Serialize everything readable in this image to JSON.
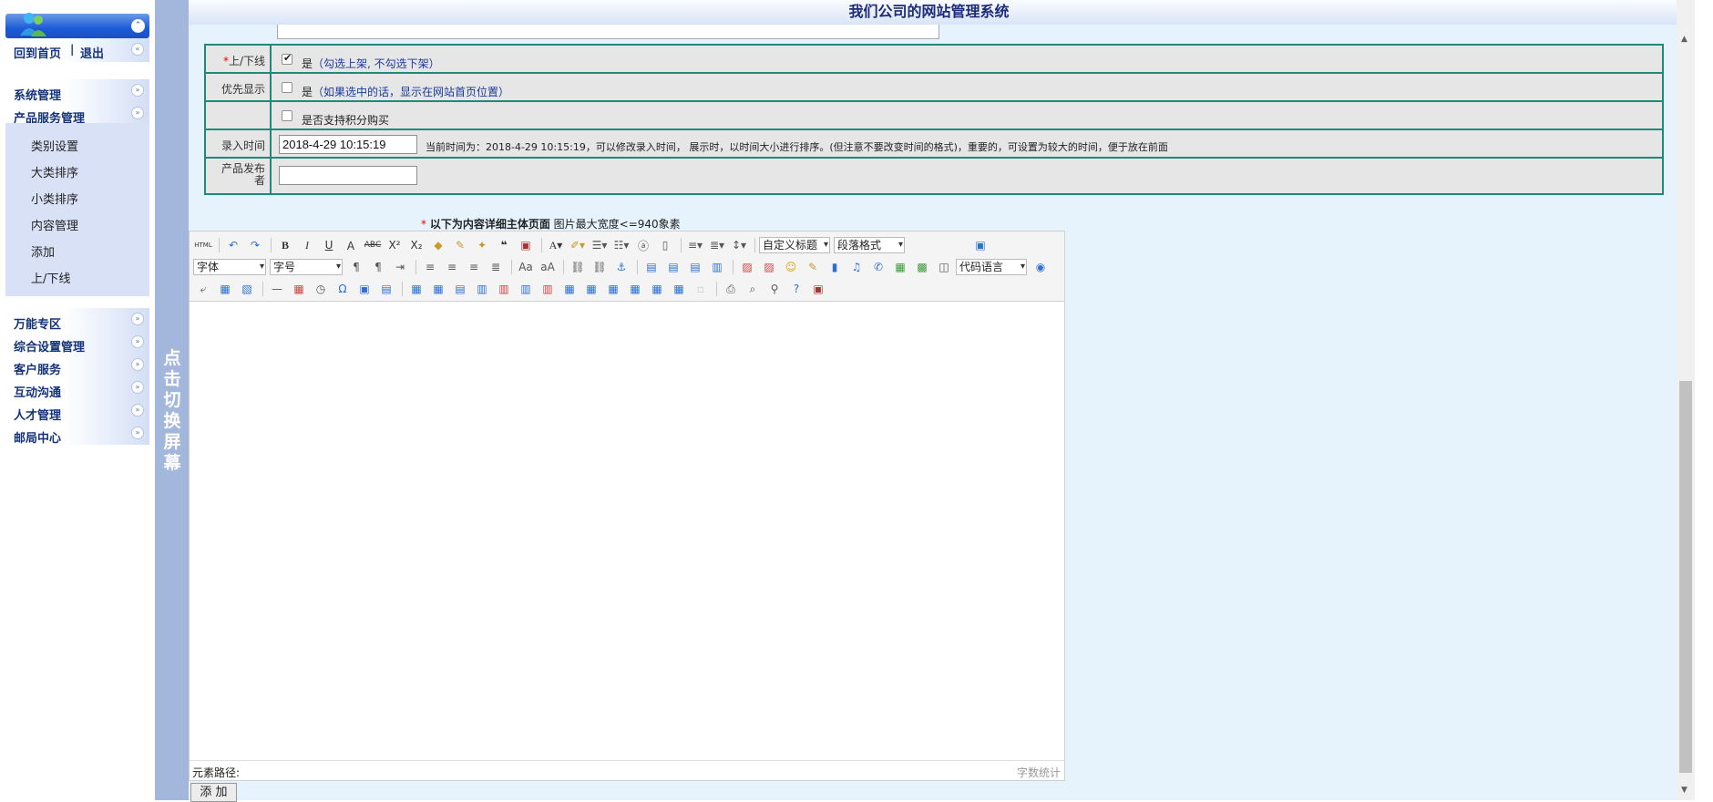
{
  "sidebar": {
    "home": "回到首页",
    "separator": "|",
    "logout": "退出",
    "menu": [
      {
        "label": "系统管理"
      },
      {
        "label": "产品服务管理"
      }
    ],
    "submenu": [
      "类别设置",
      "大类排序",
      "小类排序",
      "内容管理",
      "添加",
      "上/下线"
    ],
    "menu2": [
      {
        "label": "万能专区"
      },
      {
        "label": "综合设置管理"
      },
      {
        "label": "客户服务"
      },
      {
        "label": "互动沟通"
      },
      {
        "label": "人才管理"
      },
      {
        "label": "邮局中心"
      }
    ]
  },
  "splitter": {
    "text": "点击切换屏幕"
  },
  "header": {
    "title": "我们公司的网站管理系统"
  },
  "form": {
    "online": {
      "label": "上/下线",
      "required_mark": "*",
      "option": "是",
      "hint": "（勾选上架, 不勾选下架）"
    },
    "priority": {
      "label": "优先显示",
      "option": "是",
      "hint": "（如果选中的话，显示在网站首页位置）"
    },
    "points": {
      "option": "是否支持积分购买"
    },
    "entry_time": {
      "label": "录入时间",
      "value": "2018-4-29 10:15:19",
      "note": "当前时间为：2018-4-29 10:15:19，可以修改录入时间， 展示时，以时间大小进行排序。(但注意不要改变时间的格式)，重要的，可设置为较大的时间，便于放在前面"
    },
    "publisher": {
      "label": "产品发布者",
      "value": ""
    }
  },
  "editor": {
    "required_mark": "*",
    "title_bold": "以下为内容详细主体页面",
    "title_hint": "图片最大宽度<=940象素",
    "custom_heading": "自定义标题",
    "paragraph": "段落格式",
    "font_family": "字体",
    "font_size": "字号",
    "code_lang": "代码语言",
    "status_path": "元素路径:",
    "word_count": "字数统计"
  },
  "submit": {
    "label": "添 加"
  }
}
